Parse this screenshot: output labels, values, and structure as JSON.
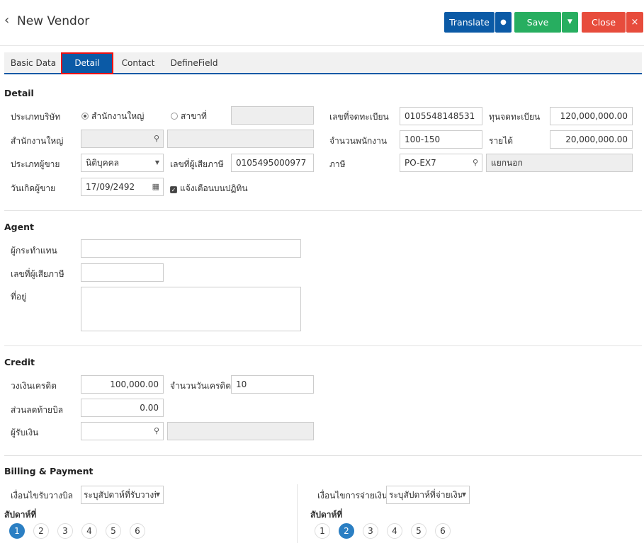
{
  "header": {
    "back_icon": "chevron-left-icon",
    "title": "New Vendor"
  },
  "toolbar": {
    "translate": "Translate",
    "save": "Save",
    "close": "Close",
    "close_x": "×"
  },
  "tabs": [
    {
      "label": "Basic Data"
    },
    {
      "label": "Detail"
    },
    {
      "label": "Contact"
    },
    {
      "label": "DefineField"
    }
  ],
  "detail": {
    "section": "Detail",
    "company_type_label": "ประเภทบริษัท",
    "radio_hq": "สำนักงานใหญ่",
    "radio_branch": "สาขาที่",
    "reg_no_label": "เลขที่จดทะเบียน",
    "reg_no": "0105548148531",
    "capital_label": "ทุนจดทะเบียน",
    "capital": "120,000,000.00",
    "hq_label": "สำนักงานใหญ่",
    "employees_label": "จำนวนพนักงาน",
    "employees": "100-150",
    "income_label": "รายได้",
    "income": "20,000,000.00",
    "vendor_type_label": "ประเภทผู้ขาย",
    "vendor_type": "นิติบุคคล",
    "tax_id_label": "เลขที่ผู้เสียภาษี",
    "tax_id": "0105495000977",
    "tax_label": "ภาษี",
    "tax": "PO-EX7",
    "tax_desc": "แยกนอก",
    "birth_label": "วันเกิดผู้ขาย",
    "birth": "17/09/2492",
    "notify": "แจ้งเตือนบนปฏิทิน"
  },
  "agent": {
    "section": "Agent",
    "agent_label": "ผู้กระทำแทน",
    "tax_id_label": "เลขที่ผู้เสียภาษี",
    "address_label": "ที่อยู่"
  },
  "credit": {
    "section": "Credit",
    "limit_label": "วงเงินเครดิต",
    "limit": "100,000.00",
    "days_label": "จำนวนวันเครดิต",
    "days": "10",
    "discount_label": "ส่วนลดท้ายบิล",
    "discount": "0.00",
    "payee_label": "ผู้รับเงิน"
  },
  "billing": {
    "section": "Billing & Payment",
    "billing_cond_label": "เงื่อนไขรับวางบิล",
    "billing_cond": "ระบุสัปดาห์ที่รับวางบิ",
    "payment_cond_label": "เงื่อนไขการจ่ายเงิน",
    "payment_cond": "ระบุสัปดาห์ที่จ่ายเงิน",
    "week_label_left": "สัปดาห์ที่",
    "week_label_right": "สัปดาห์ที่",
    "weeks": [
      "1",
      "2",
      "3",
      "4",
      "5",
      "6"
    ],
    "selected_left": "1",
    "selected_right": "2"
  },
  "colors": {
    "primary": "#0b5aa6",
    "save": "#27ae60",
    "close": "#e74c3c",
    "accent": "#2b7fc3"
  }
}
